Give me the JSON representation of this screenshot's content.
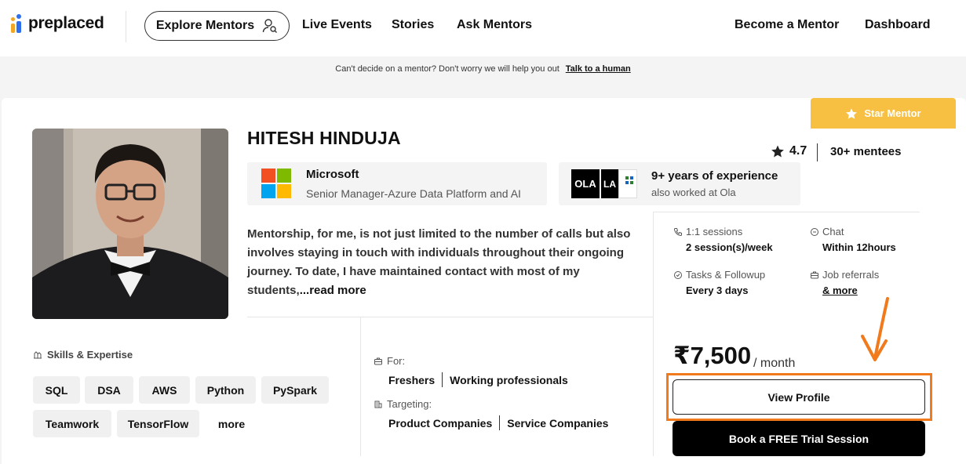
{
  "nav": {
    "logo_text": "preplaced",
    "explore": "Explore Mentors",
    "links": [
      "Live Events",
      "Stories",
      "Ask Mentors"
    ],
    "right_links": [
      "Become a Mentor",
      "Dashboard"
    ]
  },
  "banner": {
    "text": "Can't decide on a mentor? Don't worry we will help you out",
    "link": "Talk to a human"
  },
  "mentor": {
    "badge": "Star Mentor",
    "name": "HITESH HINDUJA",
    "rating": "4.7",
    "mentees": "30+ mentees",
    "company": "Microsoft",
    "role": "Senior Manager-Azure Data Platform and AI",
    "experience": "9+ years of experience",
    "also_worked": "also worked at Ola",
    "prev_logo_1": "OLA",
    "prev_logo_2": "LA",
    "about": "Mentorship, for me, is not just limited to the number of calls but also involves staying in touch with individuals throughout their ongoing journey. To date, I have maintained contact with most of my students,",
    "read_more": "...read more"
  },
  "features": [
    {
      "label": "1:1 sessions",
      "value": "2 session(s)/week"
    },
    {
      "label": "Chat",
      "value": "Within 12hours"
    },
    {
      "label": "Tasks & Followup",
      "value": "Every 3 days"
    },
    {
      "label": "Job referrals",
      "value": "& more"
    }
  ],
  "skills": {
    "title": "Skills & Expertise",
    "items": [
      "SQL",
      "DSA",
      "AWS",
      "Python",
      "PySpark",
      "Teamwork",
      "TensorFlow"
    ],
    "more": "more"
  },
  "audience": {
    "for_label": "For:",
    "for_values": [
      "Freshers",
      "Working professionals"
    ],
    "target_label": "Targeting:",
    "target_values": [
      "Product Companies",
      "Service Companies"
    ]
  },
  "pricing": {
    "price": "₹7,500",
    "period": "/ month",
    "view_profile": "View Profile",
    "book_trial": "Book a FREE Trial Session"
  },
  "colors": {
    "accent_orange": "#f07a1c",
    "badge_yellow": "#f7c042",
    "ms_red": "#f25022",
    "ms_green": "#7fba00",
    "ms_blue": "#00a4ef",
    "ms_yellow": "#ffb900"
  }
}
